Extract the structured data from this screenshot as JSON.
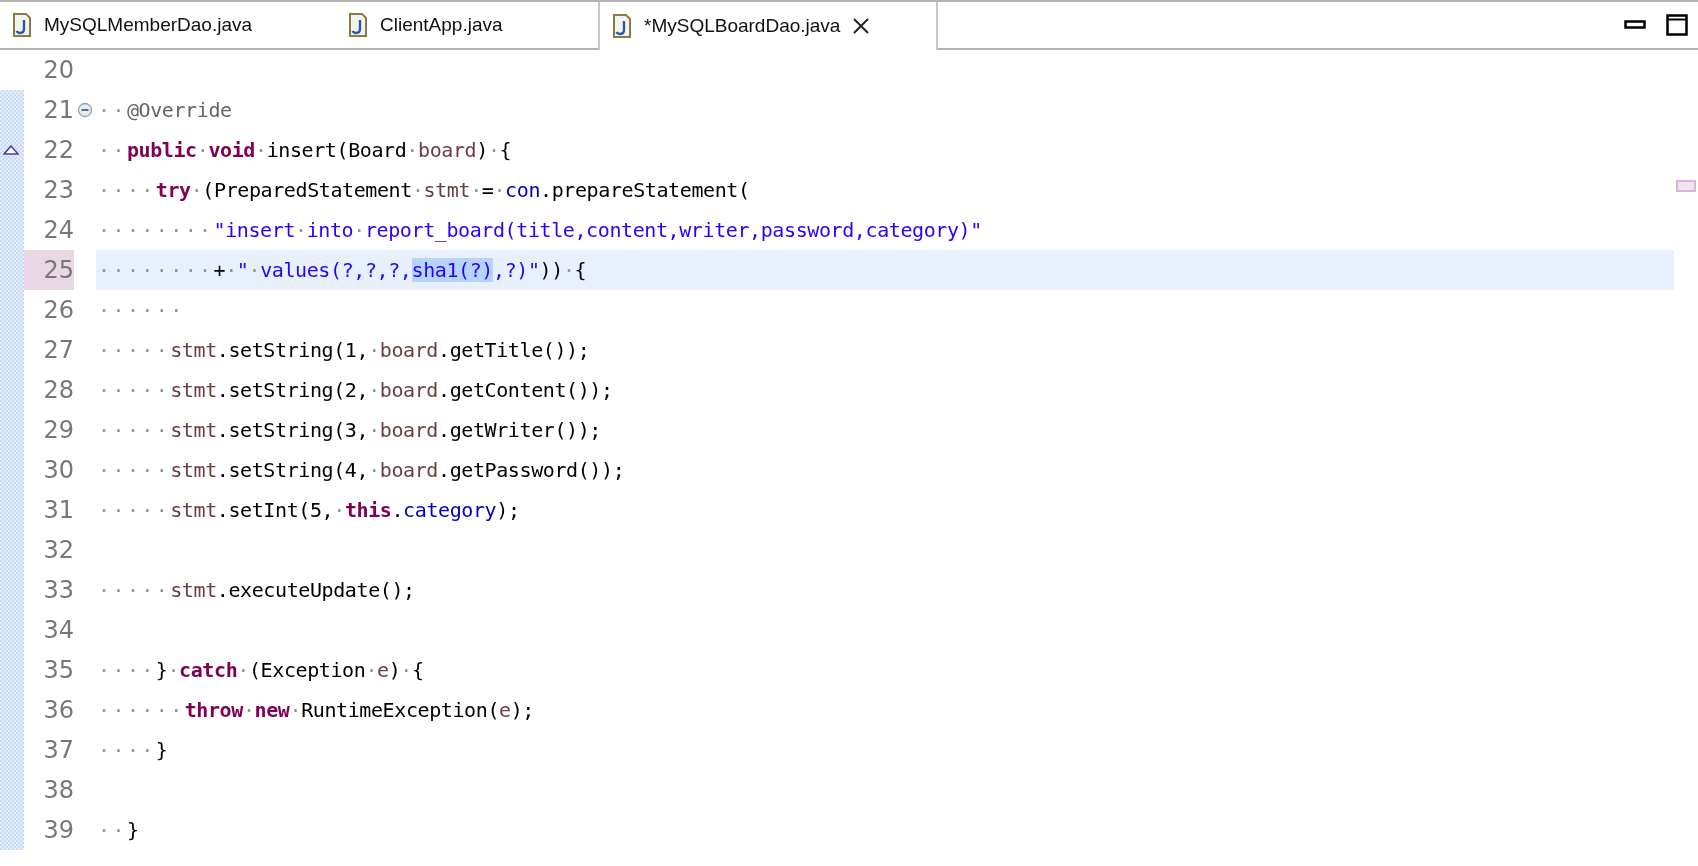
{
  "tabs": [
    {
      "label": "MySQLMemberDao.java",
      "selected": false
    },
    {
      "label": "ClientApp.java",
      "selected": false
    },
    {
      "label": "*MySQLBoardDao.java",
      "selected": true
    }
  ],
  "lines": [
    {
      "number": "20",
      "current": false,
      "range": false,
      "fold": false,
      "override": false
    },
    {
      "number": "21",
      "current": false,
      "range": true,
      "fold": true,
      "override": false,
      "tokens": [
        {
          "kind": "indent",
          "text": "··"
        },
        {
          "kind": "annotation",
          "text": "@Override"
        }
      ]
    },
    {
      "number": "22",
      "current": false,
      "range": true,
      "fold": false,
      "override": true,
      "tokens": [
        {
          "kind": "indent",
          "text": "··"
        },
        {
          "kind": "keyword",
          "text": "public"
        },
        {
          "kind": "space",
          "text": "·"
        },
        {
          "kind": "keyword",
          "text": "void"
        },
        {
          "kind": "space",
          "text": "·"
        },
        {
          "kind": "plain",
          "text": "insert(Board"
        },
        {
          "kind": "space",
          "text": "·"
        },
        {
          "kind": "local",
          "text": "board"
        },
        {
          "kind": "plain",
          "text": ")"
        },
        {
          "kind": "space",
          "text": "·"
        },
        {
          "kind": "plain",
          "text": "{"
        }
      ]
    },
    {
      "number": "23",
      "current": false,
      "range": true,
      "fold": false,
      "override": false,
      "tokens": [
        {
          "kind": "indent",
          "text": "····"
        },
        {
          "kind": "keyword",
          "text": "try"
        },
        {
          "kind": "space",
          "text": "·"
        },
        {
          "kind": "plain",
          "text": "(PreparedStatement"
        },
        {
          "kind": "space",
          "text": "·"
        },
        {
          "kind": "local",
          "text": "stmt"
        },
        {
          "kind": "space",
          "text": "·"
        },
        {
          "kind": "plain",
          "text": "="
        },
        {
          "kind": "space",
          "text": "·"
        },
        {
          "kind": "field",
          "text": "con"
        },
        {
          "kind": "plain",
          "text": ".prepareStatement("
        }
      ]
    },
    {
      "number": "24",
      "current": false,
      "range": true,
      "fold": false,
      "override": false,
      "tokens": [
        {
          "kind": "indent",
          "text": "········"
        },
        {
          "kind": "string",
          "text": "\"insert"
        },
        {
          "kind": "space",
          "text": "·"
        },
        {
          "kind": "string",
          "text": "into"
        },
        {
          "kind": "space",
          "text": "·"
        },
        {
          "kind": "string",
          "text": "report_board(title,content,writer,password,category)\""
        }
      ]
    },
    {
      "number": "25",
      "current": true,
      "range": true,
      "fold": false,
      "override": false,
      "tokens": [
        {
          "kind": "indent",
          "text": "········"
        },
        {
          "kind": "plain",
          "text": "+"
        },
        {
          "kind": "space",
          "text": "·"
        },
        {
          "kind": "string",
          "text": "\""
        },
        {
          "kind": "space",
          "text": "·"
        },
        {
          "kind": "string",
          "text": "values(?,?,?,"
        },
        {
          "kind": "selection",
          "text": "sha1(?)"
        },
        {
          "kind": "string",
          "text": ",?)\""
        },
        {
          "kind": "plain",
          "text": "))"
        },
        {
          "kind": "space",
          "text": "·"
        },
        {
          "kind": "plain",
          "text": "{"
        }
      ]
    },
    {
      "number": "26",
      "current": false,
      "range": true,
      "fold": false,
      "override": false,
      "tokens": [
        {
          "kind": "indent",
          "text": "······"
        }
      ]
    },
    {
      "number": "27",
      "current": false,
      "range": true,
      "fold": false,
      "override": false,
      "tokens": [
        {
          "kind": "indent",
          "text": "·····"
        },
        {
          "kind": "local",
          "text": "stmt"
        },
        {
          "kind": "plain",
          "text": ".setString(1,"
        },
        {
          "kind": "space",
          "text": "·"
        },
        {
          "kind": "local",
          "text": "board"
        },
        {
          "kind": "plain",
          "text": ".getTitle());"
        }
      ]
    },
    {
      "number": "28",
      "current": false,
      "range": true,
      "fold": false,
      "override": false,
      "tokens": [
        {
          "kind": "indent",
          "text": "·····"
        },
        {
          "kind": "local",
          "text": "stmt"
        },
        {
          "kind": "plain",
          "text": ".setString(2,"
        },
        {
          "kind": "space",
          "text": "·"
        },
        {
          "kind": "local",
          "text": "board"
        },
        {
          "kind": "plain",
          "text": ".getContent());"
        }
      ]
    },
    {
      "number": "29",
      "current": false,
      "range": true,
      "fold": false,
      "override": false,
      "tokens": [
        {
          "kind": "indent",
          "text": "·····"
        },
        {
          "kind": "local",
          "text": "stmt"
        },
        {
          "kind": "plain",
          "text": ".setString(3,"
        },
        {
          "kind": "space",
          "text": "·"
        },
        {
          "kind": "local",
          "text": "board"
        },
        {
          "kind": "plain",
          "text": ".getWriter());"
        }
      ]
    },
    {
      "number": "30",
      "current": false,
      "range": true,
      "fold": false,
      "override": false,
      "tokens": [
        {
          "kind": "indent",
          "text": "·····"
        },
        {
          "kind": "local",
          "text": "stmt"
        },
        {
          "kind": "plain",
          "text": ".setString(4,"
        },
        {
          "kind": "space",
          "text": "·"
        },
        {
          "kind": "local",
          "text": "board"
        },
        {
          "kind": "plain",
          "text": ".getPassword());"
        }
      ]
    },
    {
      "number": "31",
      "current": false,
      "range": true,
      "fold": false,
      "override": false,
      "tokens": [
        {
          "kind": "indent",
          "text": "·····"
        },
        {
          "kind": "local",
          "text": "stmt"
        },
        {
          "kind": "plain",
          "text": ".setInt(5,"
        },
        {
          "kind": "space",
          "text": "·"
        },
        {
          "kind": "keyword",
          "text": "this"
        },
        {
          "kind": "plain",
          "text": "."
        },
        {
          "kind": "field",
          "text": "category"
        },
        {
          "kind": "plain",
          "text": ");"
        }
      ]
    },
    {
      "number": "32",
      "current": false,
      "range": true,
      "fold": false,
      "override": false
    },
    {
      "number": "33",
      "current": false,
      "range": true,
      "fold": false,
      "override": false,
      "tokens": [
        {
          "kind": "indent",
          "text": "·····"
        },
        {
          "kind": "local",
          "text": "stmt"
        },
        {
          "kind": "plain",
          "text": ".executeUpdate();"
        }
      ]
    },
    {
      "number": "34",
      "current": false,
      "range": true,
      "fold": false,
      "override": false
    },
    {
      "number": "35",
      "current": false,
      "range": true,
      "fold": false,
      "override": false,
      "tokens": [
        {
          "kind": "indent",
          "text": "····"
        },
        {
          "kind": "plain",
          "text": "}"
        },
        {
          "kind": "space",
          "text": "·"
        },
        {
          "kind": "keyword",
          "text": "catch"
        },
        {
          "kind": "space",
          "text": "·"
        },
        {
          "kind": "plain",
          "text": "(Exception"
        },
        {
          "kind": "space",
          "text": "·"
        },
        {
          "kind": "local",
          "text": "e"
        },
        {
          "kind": "plain",
          "text": ")"
        },
        {
          "kind": "space",
          "text": "·"
        },
        {
          "kind": "plain",
          "text": "{"
        }
      ]
    },
    {
      "number": "36",
      "current": false,
      "range": true,
      "fold": false,
      "override": false,
      "tokens": [
        {
          "kind": "indent",
          "text": "······"
        },
        {
          "kind": "keyword",
          "text": "throw"
        },
        {
          "kind": "space",
          "text": "·"
        },
        {
          "kind": "keyword",
          "text": "new"
        },
        {
          "kind": "space",
          "text": "·"
        },
        {
          "kind": "plain",
          "text": "RuntimeException("
        },
        {
          "kind": "local",
          "text": "e"
        },
        {
          "kind": "plain",
          "text": ");"
        }
      ]
    },
    {
      "number": "37",
      "current": false,
      "range": true,
      "fold": false,
      "override": false,
      "tokens": [
        {
          "kind": "indent",
          "text": "····"
        },
        {
          "kind": "plain",
          "text": "}"
        }
      ]
    },
    {
      "number": "38",
      "current": false,
      "range": true,
      "fold": false,
      "override": false
    },
    {
      "number": "39",
      "current": false,
      "range": true,
      "fold": false,
      "override": false,
      "tokens": [
        {
          "kind": "indent",
          "text": "··"
        },
        {
          "kind": "plain",
          "text": "}"
        }
      ]
    }
  ],
  "overview_ruler": {
    "markers": [
      {
        "kind": "occurrence"
      }
    ]
  }
}
